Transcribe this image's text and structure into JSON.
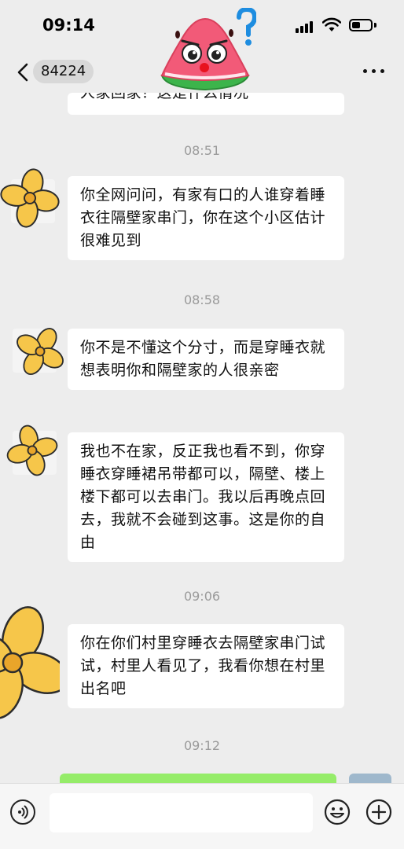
{
  "status_bar": {
    "time": "09:14",
    "battery_level": 0.45
  },
  "nav": {
    "contact_name": "84224",
    "back_icon": "chevron-left-icon",
    "more_icon": "more-dots-icon",
    "sticker_icon": "watermelon-question-sticker-icon"
  },
  "messages": [
    {
      "type": "text",
      "sender": "other",
      "text": "人家回家？这是什么情况"
    },
    {
      "type": "time",
      "text": "08:51"
    },
    {
      "type": "text",
      "sender": "other",
      "text": "你全网问问，有家有口的人谁穿着睡衣往隔壁家串门，你在这个小区估计很难见到"
    },
    {
      "type": "time",
      "text": "08:58"
    },
    {
      "type": "text",
      "sender": "other",
      "text": "你不是不懂这个分寸，而是穿睡衣就想表明你和隔壁家的人很亲密"
    },
    {
      "type": "text",
      "sender": "other",
      "text": "我也不在家，反正我也看不到，你穿睡衣穿睡裙吊带都可以，隔壁、楼上楼下都可以去串门。我以后再晚点回去，我就不会碰到这事。这是你的自由"
    },
    {
      "type": "time",
      "text": "09:06"
    },
    {
      "type": "text",
      "sender": "other",
      "text": "你在你们村里穿睡衣去隔壁家串门试试，村里人看见了，我看你想在村里出名吧"
    },
    {
      "type": "time",
      "text": "09:12"
    },
    {
      "type": "text",
      "sender": "self",
      "text": ""
    }
  ],
  "input_bar": {
    "voice_icon": "voice-icon",
    "emoji_icon": "emoji-icon",
    "plus_icon": "plus-icon",
    "placeholder": ""
  },
  "colors": {
    "background": "#ededed",
    "bubble_other": "#ffffff",
    "bubble_self": "#95ec69",
    "timestamp": "#9a9a9a",
    "flower_petal": "#f6c64a"
  }
}
